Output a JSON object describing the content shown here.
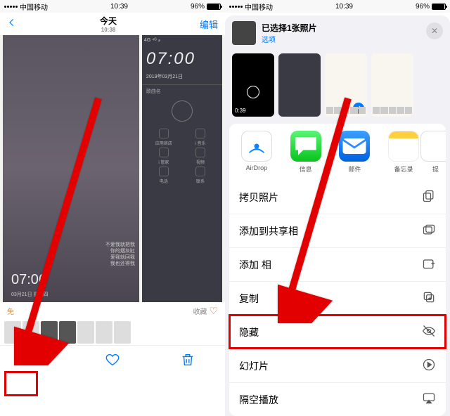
{
  "status": {
    "carrier": "中国移动",
    "time": "10:39",
    "battery": "96%"
  },
  "left": {
    "nav": {
      "title": "今天",
      "subtitle": "10:38",
      "edit": "编辑"
    },
    "photo": {
      "mini_signal": "4G ⁴ᴳ ᵢₗₗ",
      "clock": "07:06",
      "date": "03月21日  星期四",
      "side_clock": "07:00",
      "side_date": "2019年03月21日",
      "side_song": "歌曲名",
      "poem": "不爱我就把我\n你的烟灰缸\n爱我就回我\n我也还得我",
      "apps": {
        "a": "应用商店",
        "b": "i 音乐",
        "c": "i 管家",
        "d": "视频",
        "e": "电话",
        "f": "联系"
      }
    },
    "labels": {
      "free": "免",
      "collect": "收藏"
    }
  },
  "right": {
    "sheet": {
      "title": "已选择1张照片",
      "sub": "选项",
      "close": "✕"
    },
    "preview": {
      "duration": "0:39"
    },
    "apps": {
      "airdrop": "AirDrop",
      "messages": "信息",
      "mail": "邮件",
      "notes": "备忘录",
      "more": "提"
    },
    "actions": {
      "copy_photo": "拷贝照片",
      "shared_album": "添加到共享相",
      "add_album": "添加  相",
      "copy": "复制",
      "hide": "隐藏",
      "slideshow": "幻灯片",
      "airplay": "隔空播放"
    }
  }
}
